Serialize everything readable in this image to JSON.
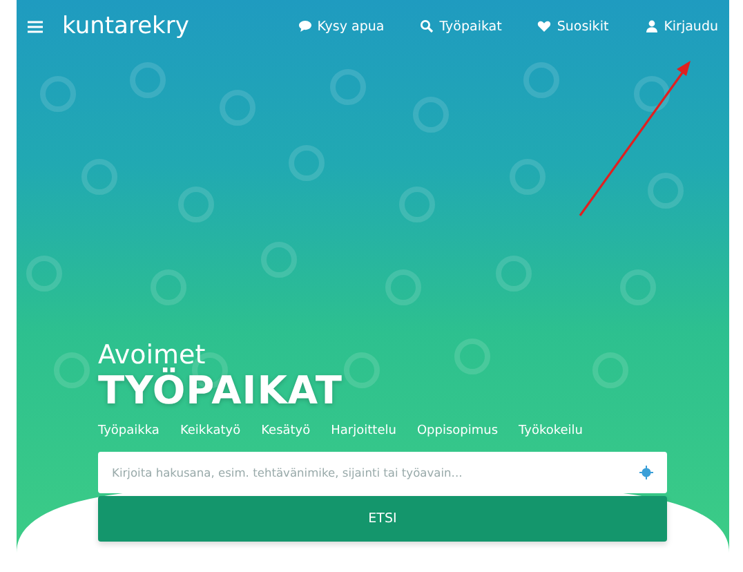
{
  "nav": {
    "logo": "kuntarekry",
    "links": [
      {
        "kind": "chat",
        "label": "Kysy apua"
      },
      {
        "kind": "search",
        "label": "Työpaikat"
      },
      {
        "kind": "heart",
        "label": "Suosikit"
      },
      {
        "kind": "user",
        "label": "Kirjaudu"
      }
    ]
  },
  "hero": {
    "kicker": "Avoimet",
    "title": "TYÖPAIKAT",
    "job_types": [
      "Työpaikka",
      "Keikkatyö",
      "Kesätyö",
      "Harjoittelu",
      "Oppisopimus",
      "Työkokeilu"
    ],
    "search": {
      "placeholder": "Kirjoita hakusana, esim. tehtävänimike, sijainti tai työavain..."
    },
    "button": "ETSI"
  }
}
